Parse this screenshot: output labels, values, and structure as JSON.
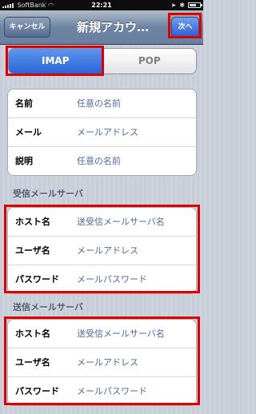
{
  "status_bar": {
    "carrier": "SoftBank",
    "time": "22:21",
    "battery_level": 0.7
  },
  "nav": {
    "cancel_label": "キャンセル",
    "title": "新規アカウ…",
    "next_label": "次へ"
  },
  "segment": {
    "options": [
      "IMAP",
      "POP"
    ],
    "selected": "IMAP"
  },
  "account_info": {
    "rows": [
      {
        "label": "名前",
        "value": "任意の名前"
      },
      {
        "label": "メール",
        "value": "メールアドレス"
      },
      {
        "label": "説明",
        "value": "任意の名前"
      }
    ]
  },
  "incoming": {
    "header": "受信メールサーバ",
    "rows": [
      {
        "label": "ホスト名",
        "value": "送受信メールサーバ名"
      },
      {
        "label": "ユーザ名",
        "value": "メールアドレス"
      },
      {
        "label": "パスワード",
        "value": "メールパスワード"
      }
    ]
  },
  "outgoing": {
    "header": "送信メールサーバ",
    "rows": [
      {
        "label": "ホスト名",
        "value": "送受信メールサーバ名"
      },
      {
        "label": "ユーザ名",
        "value": "メールアドレス"
      },
      {
        "label": "パスワード",
        "value": "メールパスワード"
      }
    ]
  },
  "colors": {
    "highlight": "#e10000",
    "accent": "#2a66d8"
  }
}
